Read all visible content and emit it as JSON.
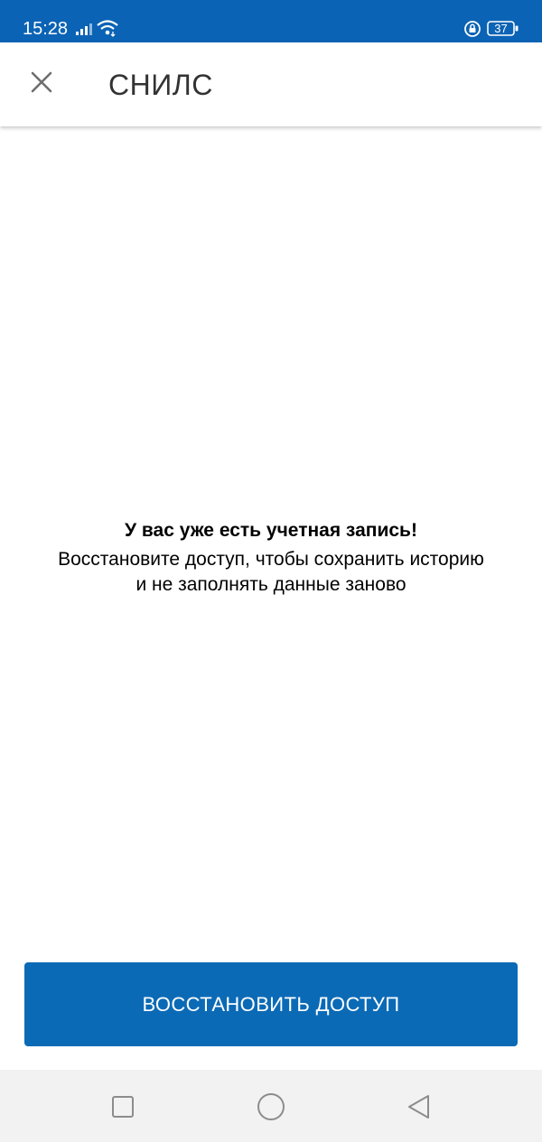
{
  "status_bar": {
    "time": "15:28",
    "battery": "37",
    "icons": [
      "signal-icon",
      "wifi-icon",
      "rotation-lock-icon",
      "battery-icon"
    ]
  },
  "app_bar": {
    "close_icon": "close-icon",
    "title": "СНИЛС"
  },
  "message": {
    "title": "У вас уже есть учетная запись!",
    "body_line1": "Восстановите доступ, чтобы сохранить историю",
    "body_line2": "и не заполнять данные заново"
  },
  "actions": {
    "restore_label": "ВОССТАНОВИТЬ ДОСТУП"
  },
  "nav_bar": {
    "icons": [
      "recent-apps-icon",
      "home-icon",
      "back-icon"
    ]
  },
  "colors": {
    "status_bar": "#0B63B5",
    "button": "#0B6AB6",
    "nav_bar": "#F2F2F2"
  }
}
